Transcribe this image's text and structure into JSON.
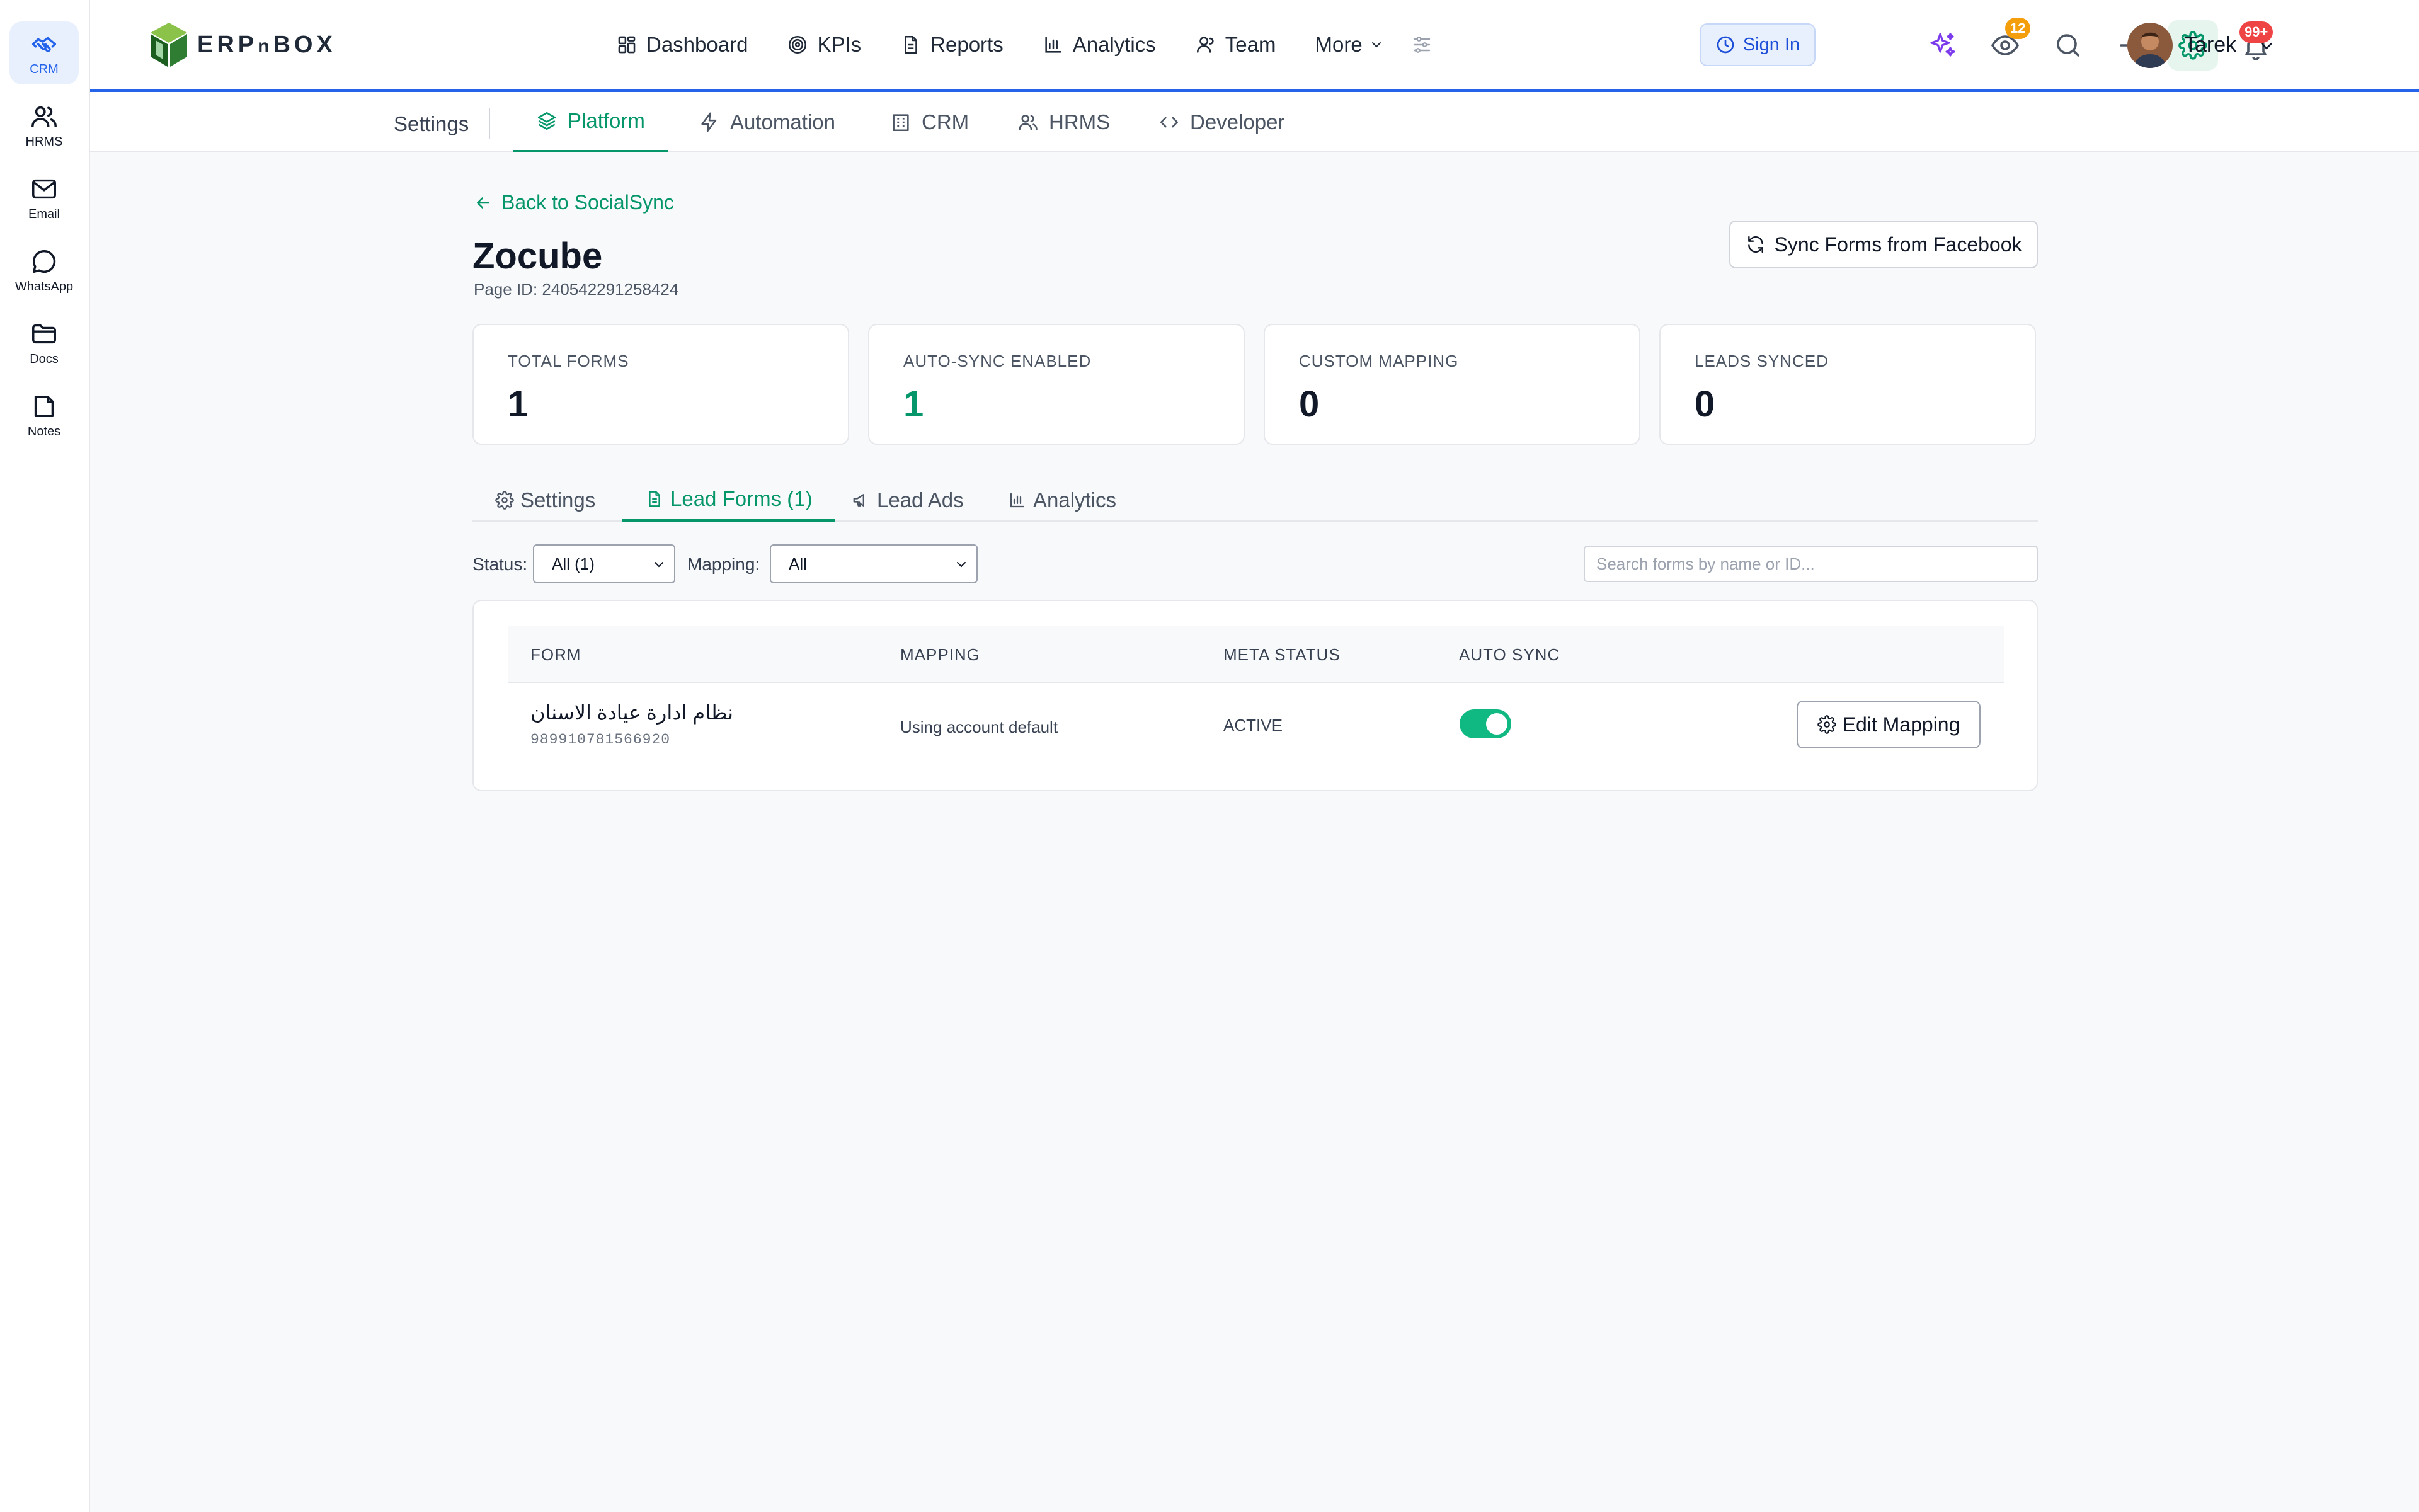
{
  "rail": {
    "items": [
      {
        "label": "CRM",
        "icon": "handshake-icon"
      },
      {
        "label": "HRMS",
        "icon": "users-icon"
      },
      {
        "label": "Email",
        "icon": "mail-icon"
      },
      {
        "label": "WhatsApp",
        "icon": "chat-bubble-icon"
      },
      {
        "label": "Docs",
        "icon": "folder-icon"
      },
      {
        "label": "Notes",
        "icon": "note-icon"
      }
    ]
  },
  "topbar": {
    "logo_text": "ERP",
    "logo_n": "n",
    "logo_box": "BOX",
    "nav": [
      {
        "label": "Dashboard",
        "icon": "dashboard-icon"
      },
      {
        "label": "KPIs",
        "icon": "target-icon"
      },
      {
        "label": "Reports",
        "icon": "document-icon"
      },
      {
        "label": "Analytics",
        "icon": "bar-chart-icon"
      },
      {
        "label": "Team",
        "icon": "user-icon"
      },
      {
        "label": "More",
        "icon": "chevron-down-icon"
      }
    ],
    "sign_in": "Sign In",
    "watch_count": "12",
    "notif_count": "99+",
    "user_name": "Tarek",
    "accent": "#2563eb"
  },
  "subnav": {
    "settings": "Settings",
    "items": [
      {
        "label": "Platform",
        "icon": "layers-icon"
      },
      {
        "label": "Automation",
        "icon": "bolt-icon"
      },
      {
        "label": "CRM",
        "icon": "building-icon"
      },
      {
        "label": "HRMS",
        "icon": "users-icon"
      },
      {
        "label": "Developer",
        "icon": "code-icon"
      }
    ]
  },
  "page": {
    "back": "Back to SocialSync",
    "title": "Zocube",
    "page_id": "Page ID: 240542291258424",
    "sync_button": "Sync Forms from Facebook"
  },
  "stats": [
    {
      "caption": "TOTAL FORMS",
      "value": "1"
    },
    {
      "caption": "AUTO-SYNC ENABLED",
      "value": "1"
    },
    {
      "caption": "CUSTOM MAPPING",
      "value": "0"
    },
    {
      "caption": "LEADS SYNCED",
      "value": "0"
    }
  ],
  "tabs": [
    {
      "label": "Settings",
      "icon": "gear-icon"
    },
    {
      "label": "Lead Forms (1)",
      "icon": "document-icon"
    },
    {
      "label": "Lead Ads",
      "icon": "megaphone-icon"
    },
    {
      "label": "Analytics",
      "icon": "bar-chart-icon"
    }
  ],
  "filters": {
    "status_label": "Status:",
    "status_value": "All (1)",
    "mapping_label": "Mapping:",
    "mapping_value": "All",
    "search_placeholder": "Search forms by name or ID..."
  },
  "table": {
    "headers": [
      "FORM",
      "MAPPING",
      "META STATUS",
      "AUTO SYNC"
    ],
    "rows": [
      {
        "form_name": "نظام ادارة عيادة الاسنان",
        "form_id": "989910781566920",
        "mapping": "Using account default",
        "meta_status": "ACTIVE",
        "auto_sync": true,
        "action": "Edit Mapping"
      }
    ]
  },
  "colors": {
    "green": "#059669",
    "toggle_on": "#10b981",
    "badge_orange": "#f59e0b",
    "badge_red": "#ef4444"
  }
}
